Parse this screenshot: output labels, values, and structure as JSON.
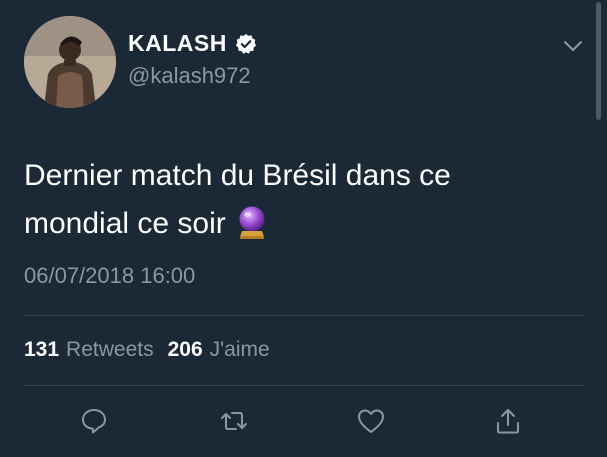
{
  "user": {
    "display_name": "KALASH",
    "handle": "@kalash972",
    "verified": true
  },
  "tweet": {
    "text_line1": "Dernier match du Brésil dans ce",
    "text_line2": "mondial ce soir",
    "emoji": "crystal-ball",
    "timestamp": "06/07/2018 16:00"
  },
  "stats": {
    "retweets_count": "131",
    "retweets_label": "Retweets",
    "likes_count": "206",
    "likes_label": "J'aime"
  },
  "actions": [
    "reply-icon",
    "retweet-icon",
    "like-icon",
    "share-icon"
  ],
  "colors": {
    "background": "#1b2836",
    "text_primary": "#ffffff",
    "text_secondary": "#8899a6",
    "divider": "#38444d"
  }
}
